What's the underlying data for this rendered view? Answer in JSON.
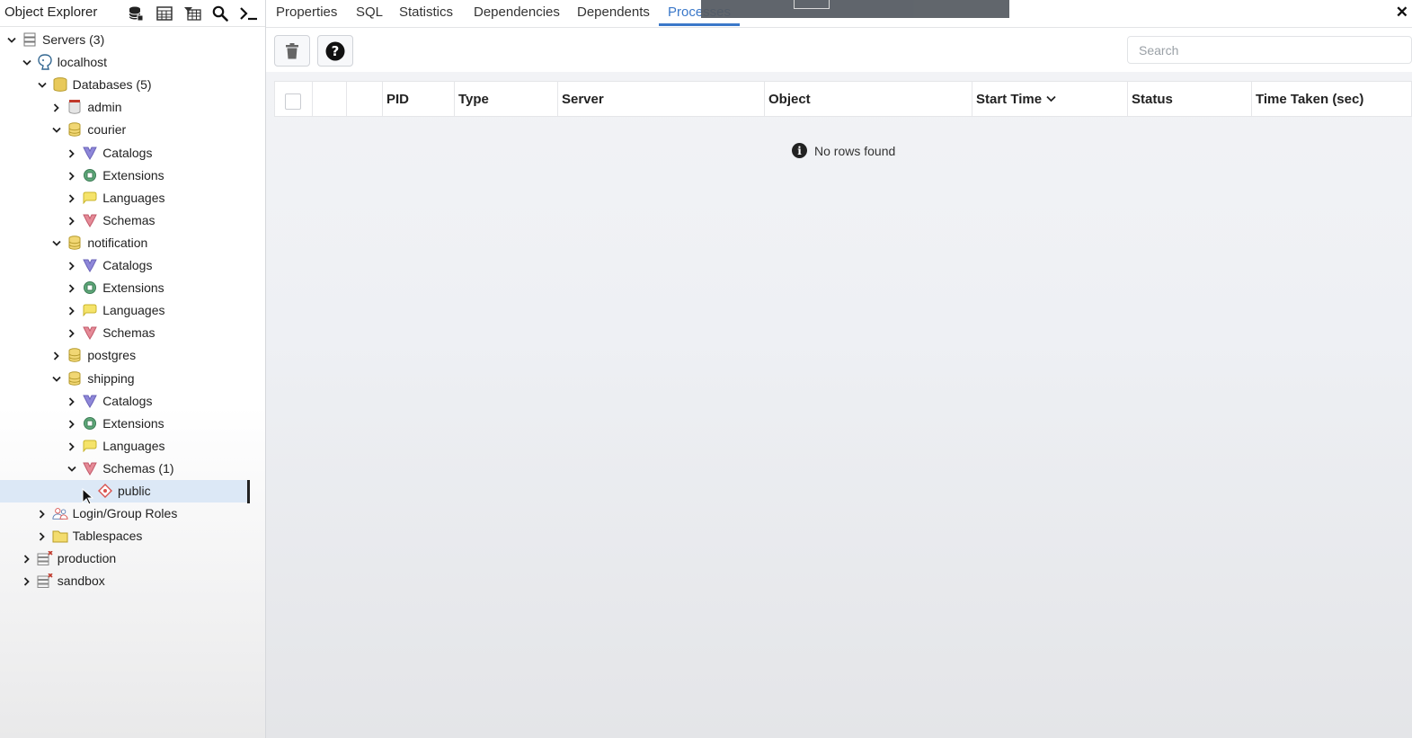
{
  "object_explorer": {
    "title": "Object Explorer",
    "toolbar_icons": [
      "database-query-icon",
      "table-view-icon",
      "filter-rows-icon",
      "search-icon",
      "psql-terminal-icon"
    ]
  },
  "tree": [
    {
      "label": "Servers (3)",
      "icon": "servers-icon",
      "expanded": true
    },
    {
      "label": "localhost",
      "icon": "postgres-server-icon",
      "expanded": true
    },
    {
      "label": "Databases (5)",
      "icon": "databases-icon",
      "expanded": true
    },
    {
      "label": "admin",
      "icon": "database-disconnected-icon",
      "expanded": false
    },
    {
      "label": "courier",
      "icon": "database-icon",
      "expanded": true
    },
    {
      "label": "Catalogs",
      "icon": "catalogs-icon",
      "expanded": false
    },
    {
      "label": "Extensions",
      "icon": "extensions-icon",
      "expanded": false
    },
    {
      "label": "Languages",
      "icon": "languages-icon",
      "expanded": false
    },
    {
      "label": "Schemas",
      "icon": "schemas-icon",
      "expanded": false
    },
    {
      "label": "notification",
      "icon": "database-icon",
      "expanded": true
    },
    {
      "label": "Catalogs",
      "icon": "catalogs-icon",
      "expanded": false
    },
    {
      "label": "Extensions",
      "icon": "extensions-icon",
      "expanded": false
    },
    {
      "label": "Languages",
      "icon": "languages-icon",
      "expanded": false
    },
    {
      "label": "Schemas",
      "icon": "schemas-icon",
      "expanded": false
    },
    {
      "label": "postgres",
      "icon": "database-icon",
      "expanded": false
    },
    {
      "label": "shipping",
      "icon": "database-icon",
      "expanded": true
    },
    {
      "label": "Catalogs",
      "icon": "catalogs-icon",
      "expanded": false
    },
    {
      "label": "Extensions",
      "icon": "extensions-icon",
      "expanded": false
    },
    {
      "label": "Languages",
      "icon": "languages-icon",
      "expanded": false
    },
    {
      "label": "Schemas (1)",
      "icon": "schemas-icon",
      "expanded": true
    },
    {
      "label": "public",
      "icon": "schema-public-icon",
      "expanded": false,
      "selected": true
    },
    {
      "label": "Login/Group Roles",
      "icon": "login-roles-icon",
      "expanded": false
    },
    {
      "label": "Tablespaces",
      "icon": "tablespaces-icon",
      "expanded": false
    },
    {
      "label": "production",
      "icon": "server-disconnected-icon",
      "expanded": false
    },
    {
      "label": "sandbox",
      "icon": "server-disconnected-icon",
      "expanded": false
    }
  ],
  "tabs": [
    {
      "label": "Properties",
      "active": false
    },
    {
      "label": "SQL",
      "active": false
    },
    {
      "label": "Statistics",
      "active": false
    },
    {
      "label": "Dependencies",
      "active": false
    },
    {
      "label": "Dependents",
      "active": false
    },
    {
      "label": "Processes",
      "active": true
    }
  ],
  "processes": {
    "search_placeholder": "Search",
    "toolbar": [
      "delete-icon",
      "help-icon"
    ],
    "columns": [
      "PID",
      "Type",
      "Server",
      "Object",
      "Start Time",
      "Status",
      "Time Taken (sec)"
    ],
    "sort_column": "Start Time",
    "sort_direction": "desc",
    "rows": [],
    "empty_message": "No rows found"
  },
  "colors": {
    "accent": "#3b78c9",
    "selection": "#dce8f6"
  }
}
